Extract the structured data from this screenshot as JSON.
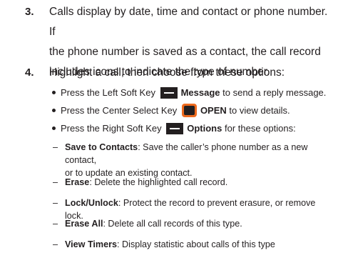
{
  "steps": [
    {
      "number": "3.",
      "text": "Calls display by date, time and contact or phone number. If\nthe phone number is saved as a contact, the call record\nincludes icons to indicate the type of number."
    },
    {
      "number": "4.",
      "text": "Highlight a call, then choose from these options:"
    }
  ],
  "bullets": [
    {
      "before": "Press the Left Soft Key",
      "key_icon": "left-soft-key-icon",
      "label": "Message",
      "after": "to send a reply message."
    },
    {
      "before": "Press the Center Select Key",
      "key_icon": "center-select-key-icon",
      "label": "OPEN",
      "after": "to view details."
    },
    {
      "before": "Press the Right Soft Key",
      "key_icon": "right-soft-key-icon",
      "label": "Options",
      "after": "for these options:"
    }
  ],
  "suboptions": [
    {
      "dash": "–",
      "term": "Save to Contacts",
      "desc": ": Save the caller’s phone number as a new contact,\nor to update an existing contact."
    },
    {
      "dash": "–",
      "term": "Erase",
      "desc": ": Delete the highlighted call record."
    },
    {
      "dash": "–",
      "term": "Lock/Unlock",
      "desc": ": Protect the record to prevent erasure, or remove lock."
    },
    {
      "dash": "–",
      "term": "Erase All",
      "desc": ": Delete all call records of this type."
    },
    {
      "dash": "–",
      "term": "View Timers",
      "desc": ": Display statistic about calls of this type"
    }
  ],
  "colors": {
    "text": "#231f20",
    "select_key_accent": "#ee6b1f"
  }
}
